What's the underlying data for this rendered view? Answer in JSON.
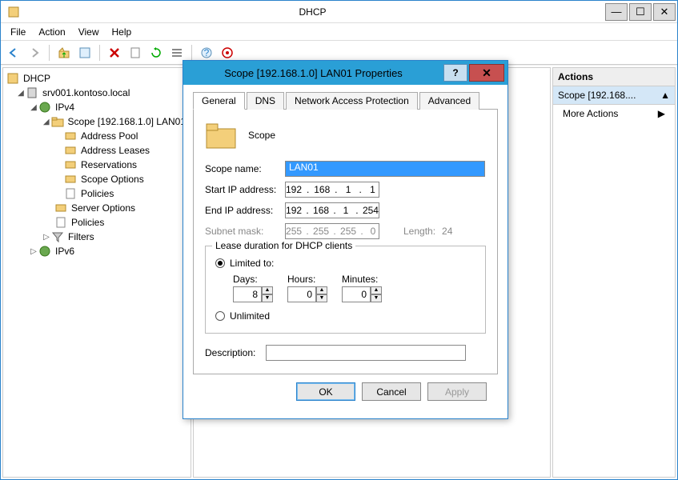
{
  "window": {
    "title": "DHCP"
  },
  "menubar": [
    "File",
    "Action",
    "View",
    "Help"
  ],
  "tree": {
    "root": "DHCP",
    "server": "srv001.kontoso.local",
    "ipv4": "IPv4",
    "scope": "Scope [192.168.1.0] LAN01",
    "scope_children": [
      "Address Pool",
      "Address Leases",
      "Reservations",
      "Scope Options",
      "Policies"
    ],
    "ipv4_tail": [
      "Server Options",
      "Policies",
      "Filters"
    ],
    "ipv6": "IPv6"
  },
  "actions": {
    "header": "Actions",
    "sub": "Scope [192.168....",
    "items": [
      "More Actions"
    ]
  },
  "dialog": {
    "title": "Scope [192.168.1.0] LAN01 Properties",
    "tabs": [
      "General",
      "DNS",
      "Network Access Protection",
      "Advanced"
    ],
    "active_tab": 0,
    "scope_heading": "Scope",
    "labels": {
      "scope_name": "Scope name:",
      "start_ip": "Start IP address:",
      "end_ip": "End IP address:",
      "subnet": "Subnet mask:",
      "length": "Length:",
      "lease_group": "Lease duration for DHCP clients",
      "limited": "Limited to:",
      "unlimited": "Unlimited",
      "days": "Days:",
      "hours": "Hours:",
      "minutes": "Minutes:",
      "description": "Description:"
    },
    "values": {
      "scope_name": "LAN01",
      "start_ip": [
        "192",
        "168",
        "1",
        "1"
      ],
      "end_ip": [
        "192",
        "168",
        "1",
        "254"
      ],
      "subnet": [
        "255",
        "255",
        "255",
        "0"
      ],
      "length": "24",
      "days": "8",
      "hours": "0",
      "minutes": "0",
      "description": ""
    },
    "buttons": {
      "ok": "OK",
      "cancel": "Cancel",
      "apply": "Apply"
    }
  }
}
